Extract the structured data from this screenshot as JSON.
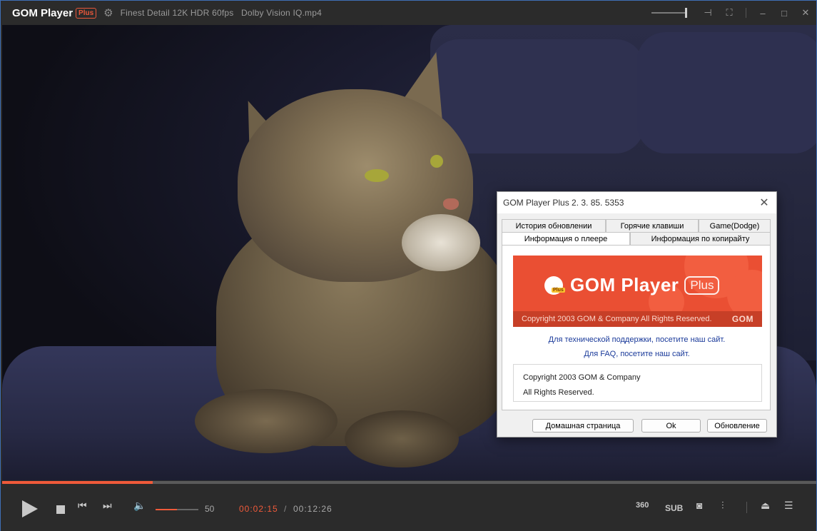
{
  "app": {
    "name": "GOM Player",
    "badge": "Plus",
    "file_title": "Finest Detail 12K HDR 60fps   Dolby Vision IQ.mp4"
  },
  "titlebar_icons": [
    "gear-icon",
    "pin-icon",
    "fullscreen-icon",
    "minimize-icon",
    "maximize-icon",
    "close-icon"
  ],
  "dialog": {
    "title": "GOM Player Plus 2. 3. 85. 5353",
    "tabs_top": [
      "История обновлении",
      "Горячие клавиши",
      "Game(Dodge)"
    ],
    "tabs_bottom": [
      "Информация о плеере",
      "Информация по копирайту"
    ],
    "active_tab": "Информация о плеере",
    "banner": {
      "logo_text": "GOM Player",
      "logo_plus": "Plus",
      "icon_badge": "Plus",
      "copyright": "Copyright 2003 GOM & Company All Rights Reserved.",
      "brand": "GOM"
    },
    "support_link": "Для технической поддержки, посетите наш сайт.",
    "faq_link": "Для FAQ, посетите наш сайт.",
    "copyright_line1": "Copyright 2003 GOM & Company",
    "copyright_line2": "All Rights Reserved.",
    "buttons": {
      "home": "Домашная страница",
      "ok": "Ok",
      "update": "Обновление"
    }
  },
  "player": {
    "progress": 0.185,
    "volume": 50,
    "volume_label": "50",
    "current_time": "00:02:15",
    "separator": "/",
    "total_time": "00:12:26",
    "right_controls": {
      "vr": "360",
      "subtitles": "SUB"
    }
  },
  "colors": {
    "accent": "#f05a3a",
    "banner": "#ea4f33",
    "window_border": "#3f6fb5"
  }
}
